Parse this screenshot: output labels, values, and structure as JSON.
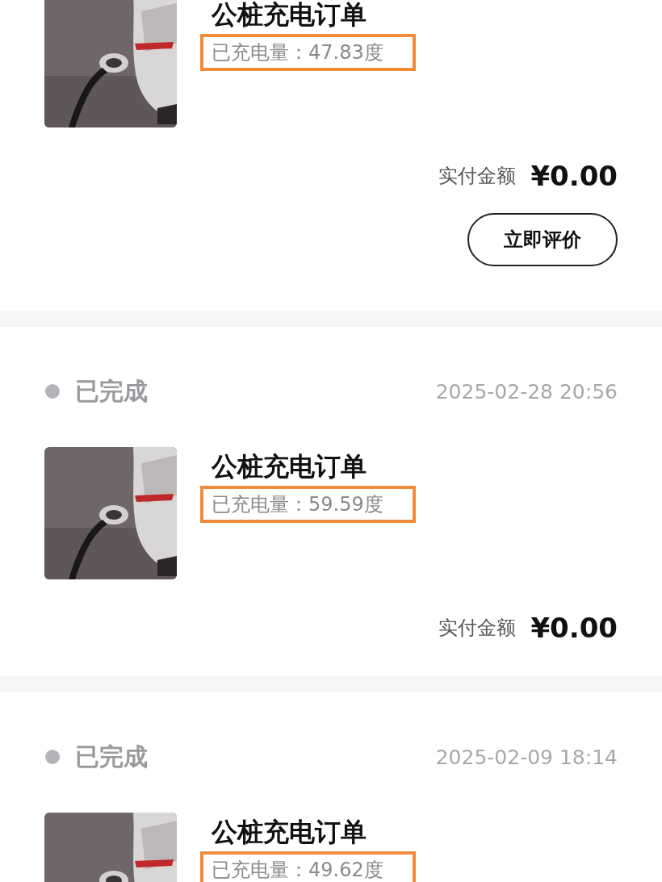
{
  "orders": [
    {
      "title": "公桩充电订单",
      "energy": "已充电量：47.83度",
      "highlighted": true,
      "paid_label": "实付金额",
      "amount": "¥0.00",
      "action": "立即评价"
    },
    {
      "status": "已完成",
      "time": "2025-02-28 20:56",
      "title": "公桩充电订单",
      "energy": "已充电量：59.59度",
      "highlighted": true,
      "paid_label": "实付金额",
      "amount": "¥0.00"
    },
    {
      "status": "已完成",
      "time": "2025-02-09 18:14",
      "title": "公桩充电订单",
      "energy": "已充电量：49.62度",
      "highlighted": true
    }
  ]
}
